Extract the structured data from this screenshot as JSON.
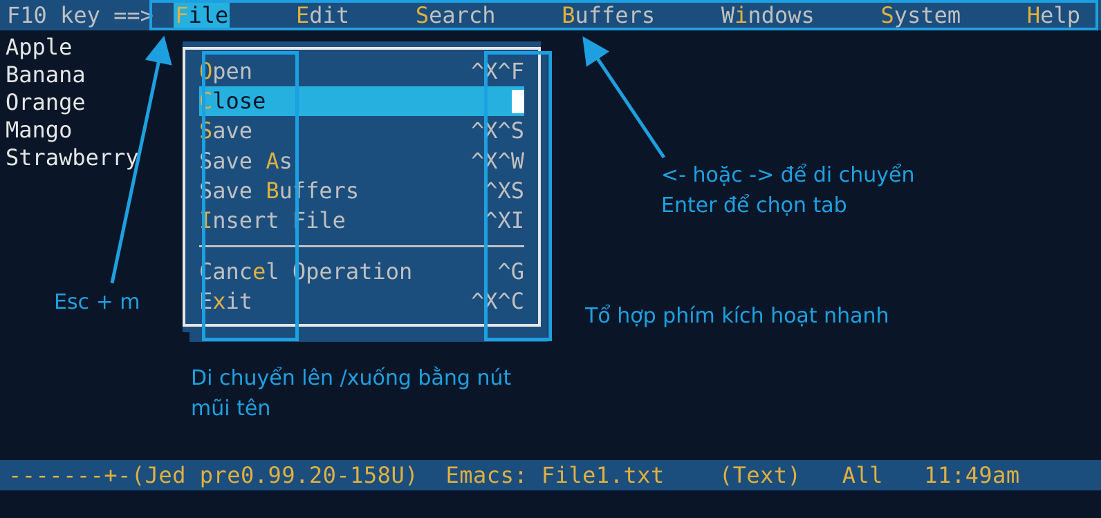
{
  "menubar": {
    "prompt": "F10 key ==> ",
    "items": [
      {
        "hotkey": "F",
        "rest": "ile",
        "selected": true
      },
      {
        "hotkey": "E",
        "rest": "dit",
        "selected": false
      },
      {
        "hotkey": "S",
        "rest": "earch",
        "selected": false
      },
      {
        "hotkey": "B",
        "rest": "uffers",
        "selected": false
      },
      {
        "pre": "W",
        "hotkey": "i",
        "rest": "ndows",
        "selected": false
      },
      {
        "hotkey": "S",
        "rest": "ystem",
        "selected": false
      },
      {
        "hotkey": "H",
        "rest": "elp",
        "selected": false
      }
    ]
  },
  "buffer": {
    "lines": [
      "Apple",
      "Banana",
      "Orange",
      "Mango",
      "Strawberry"
    ]
  },
  "dropdown": {
    "items": [
      {
        "hotkey": "O",
        "rest": "pen",
        "shortcut": "^X^F",
        "selected": false
      },
      {
        "hotkey": "C",
        "rest": "lose",
        "shortcut": "",
        "selected": true
      },
      {
        "hotkey": "S",
        "rest": "ave",
        "shortcut": "^X^S",
        "selected": false
      },
      {
        "pre": "Save ",
        "hotkey": "A",
        "rest": "s",
        "shortcut": "^X^W",
        "selected": false
      },
      {
        "pre": "Save ",
        "hotkey": "B",
        "rest": "uffers",
        "shortcut": "^XS",
        "selected": false
      },
      {
        "hotkey": "I",
        "rest": "nsert File",
        "shortcut": "^XI",
        "selected": false
      },
      {
        "separator": true
      },
      {
        "pre": "Canc",
        "hotkey": "e",
        "rest": "l Operation",
        "shortcut": "^G",
        "selected": false
      },
      {
        "pre": "E",
        "hotkey": "x",
        "rest": "it",
        "shortcut": "^X^C",
        "selected": false
      }
    ]
  },
  "annotations": {
    "esc_m": "Esc + m",
    "arrows_lr": "<- hoặc -> để di chuyển\nEnter để chọn tab",
    "shortcut_hint": "Tổ hợp phím kích hoạt nhanh",
    "updown_hint": "Di chuyển lên /xuống bằng nút\nmũi tên"
  },
  "statusbar": {
    "text": "-------+-(Jed pre0.99.20-158U)  Emacs: File1.txt    (Text)   All   11:49am"
  }
}
